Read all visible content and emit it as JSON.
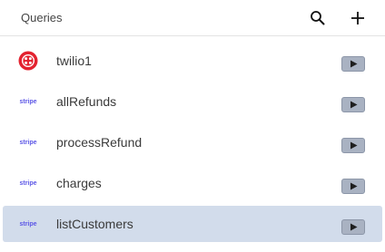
{
  "header": {
    "title": "Queries",
    "search_icon": "search-icon",
    "add_icon": "plus-icon"
  },
  "queries": [
    {
      "name": "twilio1",
      "source_icon": "twilio-logo",
      "selected": false
    },
    {
      "name": "allRefunds",
      "source_icon": "stripe-logo",
      "source_text": "stripe",
      "selected": false
    },
    {
      "name": "processRefund",
      "source_icon": "stripe-logo",
      "source_text": "stripe",
      "selected": false
    },
    {
      "name": "charges",
      "source_icon": "stripe-logo",
      "source_text": "stripe",
      "selected": false
    },
    {
      "name": "listCustomers",
      "source_icon": "stripe-logo",
      "source_text": "stripe",
      "selected": true
    }
  ],
  "colors": {
    "selected_row": "#d2dceb",
    "twilio_red": "#e3222f",
    "stripe_purple": "#5b56e6",
    "run_button": "#a9b2c2"
  }
}
